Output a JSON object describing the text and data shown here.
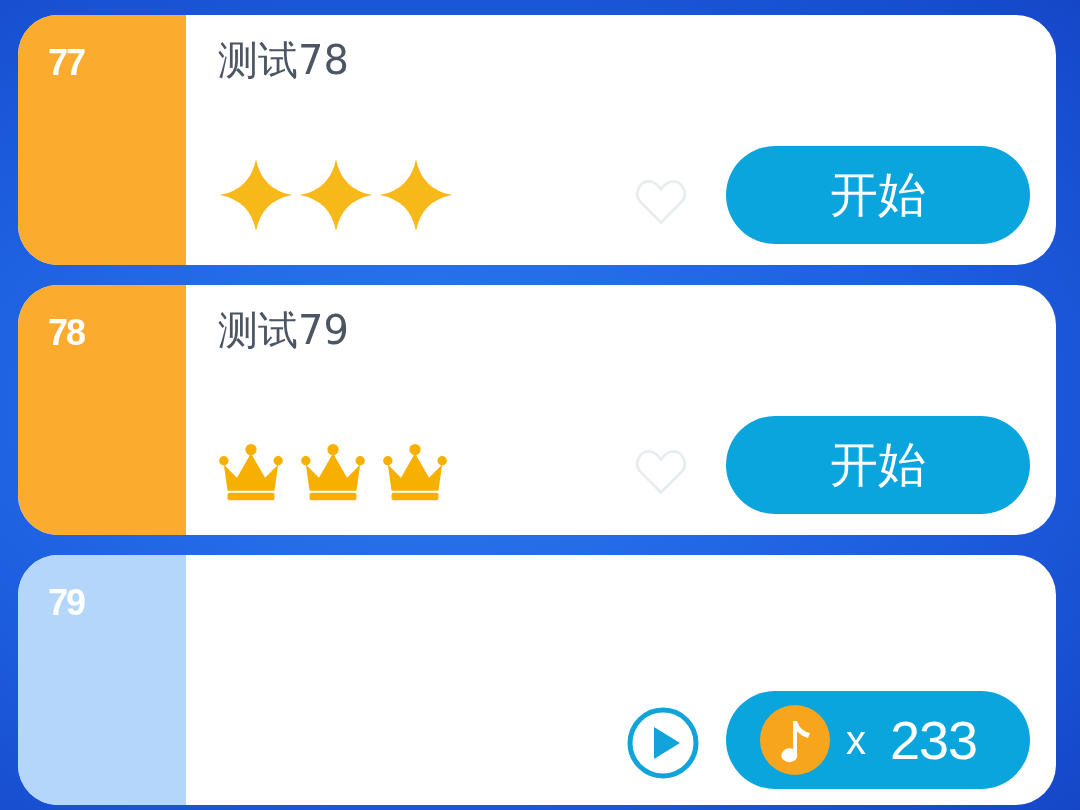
{
  "songs": [
    {
      "number": "77",
      "kind": "unlocked",
      "title": "测试78",
      "rating": {
        "kind": "sparkle",
        "stars": 3
      },
      "favorite": false,
      "button": "开始"
    },
    {
      "number": "78",
      "kind": "unlocked",
      "title": "测试79",
      "rating": {
        "kind": "crown",
        "stars": 3
      },
      "favorite": false,
      "button": "开始"
    },
    {
      "number": "79",
      "kind": "locked",
      "price": {
        "multiplier": "x",
        "amount": "233"
      }
    }
  ]
}
